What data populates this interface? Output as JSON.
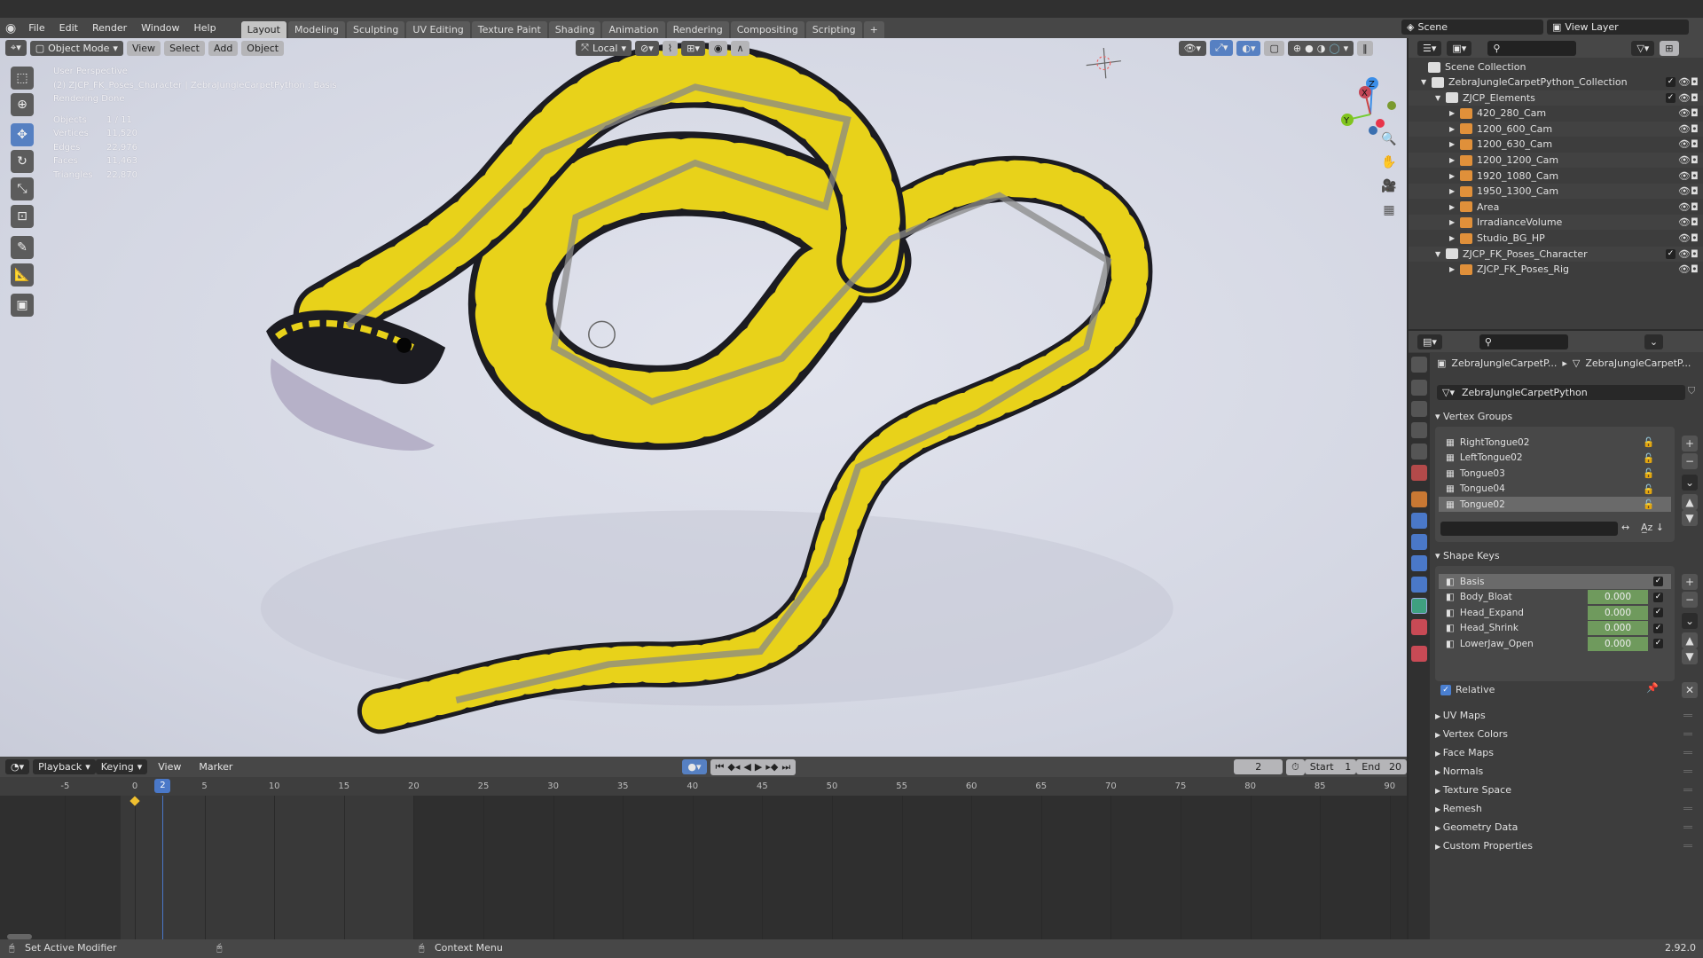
{
  "menubar": {
    "menus": [
      "File",
      "Edit",
      "Render",
      "Window",
      "Help"
    ],
    "workspaces": [
      "Layout",
      "Modeling",
      "Sculpting",
      "UV Editing",
      "Texture Paint",
      "Shading",
      "Animation",
      "Rendering",
      "Compositing",
      "Scripting"
    ],
    "active_workspace": "Layout",
    "add_tab": "+",
    "scene_label": "Scene",
    "view_layer_label": "View Layer"
  },
  "viewport": {
    "mode": "Object Mode",
    "menus": [
      "View",
      "Select",
      "Add",
      "Object"
    ],
    "orientation": "Local",
    "overlay": {
      "view": "User Perspective",
      "object": "(2) ZJCP_FK_Poses_Character | ZebraJungleCarpetPython : Basis",
      "status": "Rendering Done",
      "stats": [
        {
          "label": "Objects",
          "value": "1 / 11"
        },
        {
          "label": "Vertices",
          "value": "11,520"
        },
        {
          "label": "Edges",
          "value": "22,976"
        },
        {
          "label": "Faces",
          "value": "11,463"
        },
        {
          "label": "Triangles",
          "value": "22,870"
        }
      ]
    },
    "gizmo": {
      "x": "X",
      "y": "Y",
      "z": "Z"
    },
    "colors": {
      "snake_yellow": "#e8d21a",
      "snake_black": "#1c1c22",
      "bone": "#9a9a9a"
    }
  },
  "outliner": {
    "root": "Scene Collection",
    "items": [
      {
        "name": "ZebraJungleCarpetPython_Collection",
        "depth": 0,
        "type": "collection"
      },
      {
        "name": "ZJCP_Elements",
        "depth": 1,
        "type": "collection"
      },
      {
        "name": "420_280_Cam",
        "depth": 2,
        "type": "camera"
      },
      {
        "name": "1200_600_Cam",
        "depth": 2,
        "type": "camera"
      },
      {
        "name": "1200_630_Cam",
        "depth": 2,
        "type": "camera"
      },
      {
        "name": "1200_1200_Cam",
        "depth": 2,
        "type": "camera"
      },
      {
        "name": "1920_1080_Cam",
        "depth": 2,
        "type": "camera"
      },
      {
        "name": "1950_1300_Cam",
        "depth": 2,
        "type": "camera"
      },
      {
        "name": "Area",
        "depth": 2,
        "type": "light"
      },
      {
        "name": "IrradianceVolume",
        "depth": 2,
        "type": "probe"
      },
      {
        "name": "Studio_BG_HP",
        "depth": 2,
        "type": "mesh"
      },
      {
        "name": "ZJCP_FK_Poses_Character",
        "depth": 1,
        "type": "collection"
      },
      {
        "name": "ZJCP_FK_Poses_Rig",
        "depth": 2,
        "type": "armature"
      }
    ]
  },
  "properties": {
    "breadcrumb": [
      "ZebraJungleCarpetP...",
      "ZebraJungleCarpetP..."
    ],
    "mesh_name": "ZebraJungleCarpetPython",
    "vertex_groups": {
      "title": "Vertex Groups",
      "items": [
        "RightTongue02",
        "LeftTongue02",
        "Tongue03",
        "Tongue04",
        "Tongue02"
      ],
      "selected": 4
    },
    "shape_keys": {
      "title": "Shape Keys",
      "items": [
        {
          "name": "Basis",
          "value": ""
        },
        {
          "name": "Body_Bloat",
          "value": "0.000"
        },
        {
          "name": "Head_Expand",
          "value": "0.000"
        },
        {
          "name": "Head_Shrink",
          "value": "0.000"
        },
        {
          "name": "LowerJaw_Open",
          "value": "0.000"
        }
      ],
      "relative_label": "Relative",
      "relative": true
    },
    "panels": [
      "UV Maps",
      "Vertex Colors",
      "Face Maps",
      "Normals",
      "Texture Space",
      "Remesh",
      "Geometry Data",
      "Custom Properties"
    ]
  },
  "timeline": {
    "menus": [
      "Playback",
      "Keying",
      "View",
      "Marker"
    ],
    "current_frame": "2",
    "start_label": "Start",
    "start": "1",
    "end_label": "End",
    "end": "20",
    "ruler": [
      "-5",
      "0",
      "5",
      "10",
      "15",
      "20",
      "25",
      "30",
      "35",
      "40",
      "45",
      "50",
      "55",
      "60",
      "65",
      "70",
      "75",
      "80",
      "85",
      "90"
    ],
    "playhead": 2,
    "keyframe": 0
  },
  "status": {
    "left": "Set Active Modifier",
    "middle": "Context Menu",
    "version": "2.92.0"
  }
}
